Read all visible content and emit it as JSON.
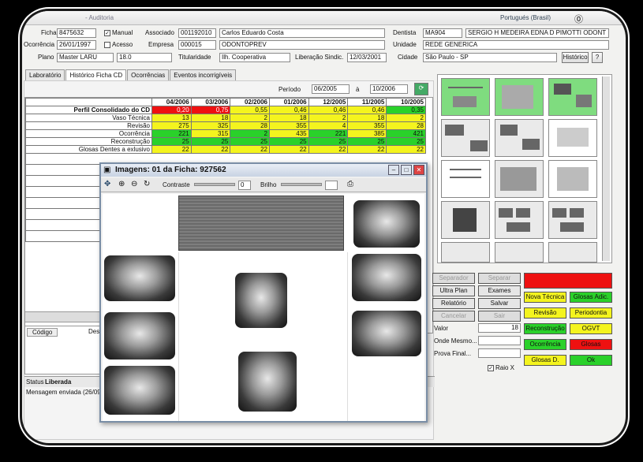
{
  "app": {
    "title": "- Auditoria",
    "title_right": "Portugués (Brasil)"
  },
  "form": {
    "fields": [
      {
        "label": "Ficha",
        "value": "8475632"
      },
      {
        "label": "Manual",
        "checked": "✓"
      },
      {
        "label": "Associado",
        "value": "001192010"
      },
      {
        "label": "name",
        "value": "Carlos Eduardo Costa"
      },
      {
        "label": "Dentista",
        "value": "MA904"
      },
      {
        "label": "dentist_name",
        "value": "SERGIO H MEDEIRA EDNA D PIMOTTI ODONT"
      },
      {
        "label": "Ocorrência",
        "value": "26/01/1997"
      },
      {
        "label": "Acesso",
        "checked": ""
      },
      {
        "label": "Empresa",
        "value": "000015"
      },
      {
        "label": "company_name",
        "value": "ODONTOPREV"
      },
      {
        "label": "Unidade",
        "value": "REDE GENERICA"
      },
      {
        "label": "Plano",
        "value": "Master LARU"
      },
      {
        "label": "plan_code",
        "value": "18.0"
      },
      {
        "label": "Titularidade",
        "value": "Ilh. Cooperativa"
      },
      {
        "label": "Liberação Sindic.",
        "value": "12/03/2001"
      },
      {
        "label": "Cidade",
        "value": "São Paulo - SP"
      }
    ],
    "buttons": [
      "Histórico",
      "?"
    ]
  },
  "tabs": [
    "Laboratório",
    "Histórico Ficha CD",
    "Ocorrências",
    "Eventos incorrigíveis"
  ],
  "period": {
    "label": "Período",
    "from": "06/2005",
    "sep": "à",
    "to": "10/2006"
  },
  "table": {
    "headers": [
      "",
      "04/2006",
      "03/2006",
      "02/2006",
      "01/2006",
      "12/2005",
      "11/2005",
      "10/2005"
    ],
    "rows": [
      {
        "label": "Perfil Consolidado do CD",
        "cells": [
          "0,20",
          "0,75",
          "0,55",
          "0,46",
          "0,46",
          "0,46",
          "0,35"
        ],
        "colors": [
          "r",
          "r",
          "y",
          "y",
          "y",
          "y",
          "g"
        ]
      },
      {
        "label": "Vaso Técnica",
        "cells": [
          "13",
          "18",
          "2",
          "18",
          "2",
          "18",
          "2"
        ],
        "colors": [
          "y",
          "y",
          "y",
          "y",
          "y",
          "y",
          "y"
        ]
      },
      {
        "label": "Revisão",
        "cells": [
          "275",
          "325",
          "28",
          "355",
          "4",
          "355",
          "28"
        ],
        "colors": [
          "y",
          "y",
          "y",
          "y",
          "y",
          "y",
          "y"
        ]
      },
      {
        "label": "Ocorrência",
        "cells": [
          "221",
          "315",
          "2",
          "435",
          "221",
          "385",
          "421"
        ],
        "colors": [
          "g",
          "y",
          "g",
          "y",
          "g",
          "y",
          "g"
        ]
      },
      {
        "label": "Reconstrução",
        "cells": [
          "25",
          "25",
          "25",
          "25",
          "25",
          "25",
          "25"
        ],
        "colors": [
          "g",
          "g",
          "g",
          "g",
          "g",
          "g",
          "g"
        ]
      },
      {
        "label": "Glosas Dentes a exlusivo",
        "cells": [
          "22",
          "22",
          "22",
          "22",
          "22",
          "22",
          "22"
        ],
        "colors": [
          "y",
          "y",
          "y",
          "y",
          "y",
          "y",
          "y"
        ]
      }
    ]
  },
  "lower_left": {
    "header_a": "Código",
    "header_b": "Des",
    "status_label": "Status",
    "status_value": "Liberada",
    "status_note": "Mensagem enviada (26/09/..."
  },
  "status_buttons": {
    "gray": [
      "Separador",
      "Separar",
      "Ultra Plan",
      "Exames",
      "Relatório",
      "Salvar",
      "Cancelar",
      "Sair",
      "Valor",
      "Onde Mesmo...",
      "Prova Final..."
    ],
    "value": "18",
    "colored": [
      {
        "label": "Nova Técnica",
        "color": "y"
      },
      {
        "label": "Glosas Adic.",
        "color": "g"
      },
      {
        "label": "Revisão",
        "color": "y"
      },
      {
        "label": "Periodontia",
        "color": "y"
      },
      {
        "label": "Reconstrução",
        "color": "g"
      },
      {
        "label": "OGVT",
        "color": "y"
      },
      {
        "label": "Ocorrência",
        "color": "g"
      },
      {
        "label": "Glosas",
        "color": "r"
      },
      {
        "label": "Glosas D.",
        "color": "y"
      },
      {
        "label": "Ok",
        "color": "g"
      }
    ],
    "check_label": "Raio X"
  },
  "image_window": {
    "title": "Imagens: 01 da Ficha: 927562",
    "contrast_label": "Contraste",
    "contrast_value": "0",
    "brightness_label": "Brilho"
  },
  "colors": {
    "red": "#ee1111",
    "yellow": "#f4f41e",
    "green": "#2ad12a"
  }
}
